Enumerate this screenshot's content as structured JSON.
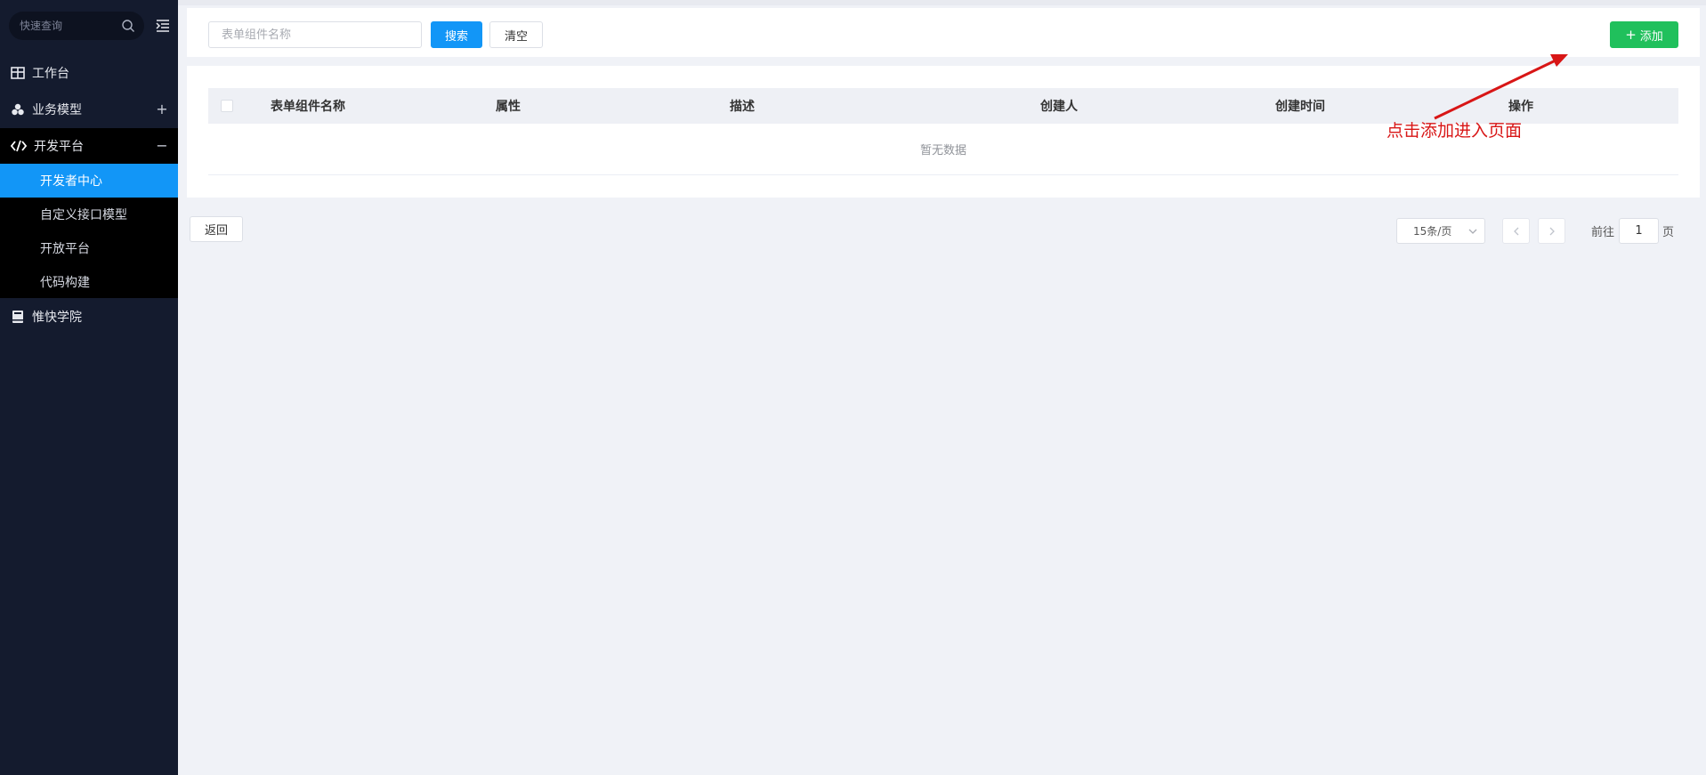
{
  "sidebar": {
    "search_placeholder": "快速查询",
    "menu": [
      {
        "label": "工作台",
        "icon": "table-grid-icon"
      },
      {
        "label": "业务模型",
        "icon": "cubes-icon",
        "right": "+"
      },
      {
        "label": "开发平台",
        "icon": "code-icon",
        "right": "−"
      },
      {
        "label": "惟快学院",
        "icon": "book-icon"
      }
    ],
    "submenu": [
      {
        "label": "开发者中心",
        "active": true
      },
      {
        "label": "自定义接口模型"
      },
      {
        "label": "开放平台"
      },
      {
        "label": "代码构建"
      }
    ]
  },
  "toolbar": {
    "search_placeholder": "表单组件名称",
    "search_label": "搜索",
    "clear_label": "清空",
    "add_label": "添加"
  },
  "table": {
    "columns": [
      "表单组件名称",
      "属性",
      "描述",
      "创建人",
      "创建时间",
      "操作"
    ],
    "empty_text": "暂无数据"
  },
  "annotation": {
    "text": "点击添加进入页面",
    "color": "#d81616"
  },
  "footer": {
    "back_label": "返回",
    "page_size": "15条/页",
    "goto_label": "前往",
    "goto_value": "1",
    "goto_suffix": "页"
  },
  "colors": {
    "sidebar_bg": "#141b2e",
    "accent": "#1296f7",
    "add_green": "#20c05c"
  }
}
